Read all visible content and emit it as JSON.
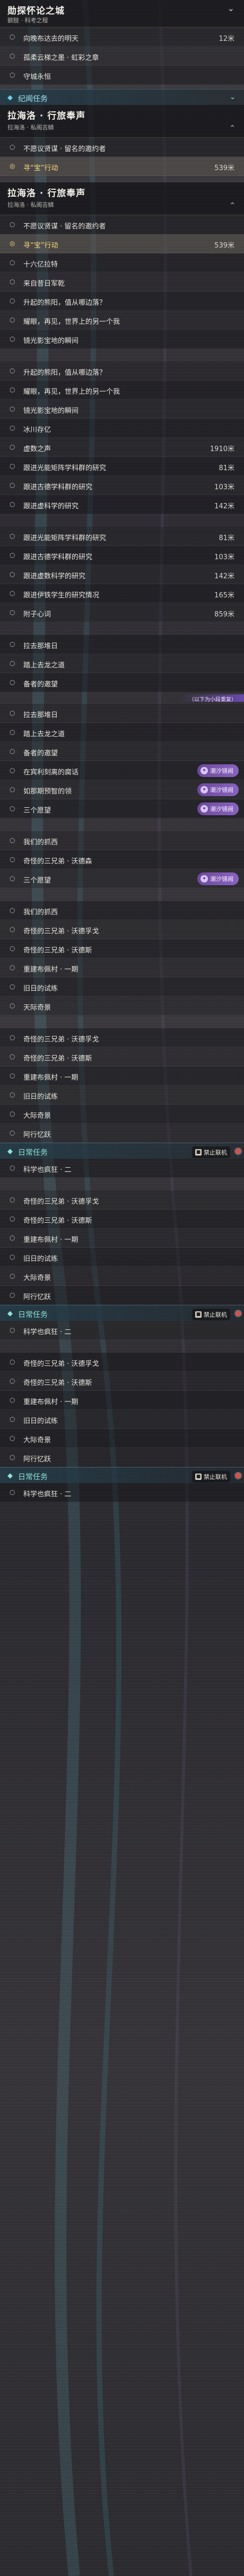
{
  "headers": {
    "h0": {
      "title": "勋探怀论之城",
      "sub": "额肢 · 科考之程"
    },
    "h1": {
      "title": "拉海洛 · 行旅奉声",
      "sub": "拉海洛 · 私阁吉鳞"
    },
    "h2": {
      "title": "拉海洛 · 行旅奉声",
      "sub": "拉海洛 · 私阁吉鳞"
    }
  },
  "sections": {
    "teleport": "纪闻任务",
    "daily": "日常任务"
  },
  "badges": {
    "tide": "潮汐镜阙"
  },
  "locks": {
    "no_coop": "禁止联机"
  },
  "banners": {
    "b1": "（以下为小段重复）"
  },
  "rows": [
    {
      "label": "向晚布达去的明天",
      "dist": "12米"
    },
    {
      "label": "孤柔云梯之墨 · 虹彩之章",
      "dist": ""
    },
    {
      "label": "守城永恒",
      "dist": ""
    },
    {
      "label": "不愿议贤谋 · 留名的邀约者",
      "dist": ""
    },
    {
      "label": "寻“宝”行动",
      "dist": "539米"
    },
    {
      "label": "不愿议贤谋 · 留名的邀约者",
      "dist": ""
    },
    {
      "label": "寻“宝”行动",
      "dist": "539米"
    },
    {
      "label": "十六亿拉特",
      "dist": ""
    },
    {
      "label": "来自昔日军乾",
      "dist": ""
    },
    {
      "label": "升起的熊阳，值从哪边落？",
      "dist": ""
    },
    {
      "label": "耀眼，再见，世界上的另一个我",
      "dist": ""
    },
    {
      "label": "镜光影宝地的瞬间",
      "dist": ""
    },
    {
      "label": "升起的熊阳，值从哪边落？",
      "dist": ""
    },
    {
      "label": "耀眼，再见，世界上的另一个我",
      "dist": ""
    },
    {
      "label": "镜光影宝地的瞬间",
      "dist": ""
    },
    {
      "label": "冰川存亿",
      "dist": ""
    },
    {
      "label": "虚数之声",
      "dist": "1910米"
    },
    {
      "label": "跟进光能矩阵学科群的研究",
      "dist": "81米"
    },
    {
      "label": "跟进古德学科群的研究",
      "dist": "103米"
    },
    {
      "label": "跟进虚科学的研究",
      "dist": "142米"
    },
    {
      "label": "跟进光能矩阵学科群的研究",
      "dist": "81米"
    },
    {
      "label": "跟进古德学科群的研究",
      "dist": "103米"
    },
    {
      "label": "跟进虚数科学的研究",
      "dist": "142米"
    },
    {
      "label": "跟进伊铁学生的研究情况",
      "dist": "165米"
    },
    {
      "label": "附子心词",
      "dist": "859米"
    },
    {
      "label": "拉去那堆日",
      "dist": ""
    },
    {
      "label": "踏上去龙之道",
      "dist": ""
    },
    {
      "label": "备者的邀望",
      "dist": ""
    },
    {
      "label": "拉去那堆日",
      "dist": ""
    },
    {
      "label": "踏上去龙之道",
      "dist": ""
    },
    {
      "label": "备者的邀望",
      "dist": ""
    },
    {
      "label": "在宾利刻离的腐话",
      "dist": ""
    },
    {
      "label": "如那期预智的领",
      "dist": ""
    },
    {
      "label": "三个愿望",
      "dist": ""
    },
    {
      "label": "我们的抓西",
      "dist": ""
    },
    {
      "label": "奇怪的三兄弟 · 沃德森",
      "dist": ""
    },
    {
      "label": "三个愿望",
      "dist": ""
    },
    {
      "label": "我们的抓西",
      "dist": ""
    },
    {
      "label": "奇怪的三兄弟 · 沃德孚戈",
      "dist": ""
    },
    {
      "label": "奇怪的三兄弟 · 沃德斯",
      "dist": ""
    },
    {
      "label": "重建布佩村 · 一期",
      "dist": ""
    },
    {
      "label": "旧日的试练",
      "dist": ""
    },
    {
      "label": "天际奇景",
      "dist": ""
    },
    {
      "label": "奇怪的三兄弟 · 沃德孚戈",
      "dist": ""
    },
    {
      "label": "奇怪的三兄弟 · 沃德斯",
      "dist": ""
    },
    {
      "label": "重建布佩村 · 一期",
      "dist": ""
    },
    {
      "label": "旧日的试练",
      "dist": ""
    },
    {
      "label": "大际奇景",
      "dist": ""
    },
    {
      "label": "阿行忆跃",
      "dist": ""
    },
    {
      "label": "科学也疯狂 · 二",
      "dist": ""
    },
    {
      "label": "奇怪的三兄弟 · 沃德孚戈",
      "dist": ""
    },
    {
      "label": "奇怪的三兄弟 · 沃德斯",
      "dist": ""
    },
    {
      "label": "重建布佩村 · 一期",
      "dist": ""
    },
    {
      "label": "旧日的试练",
      "dist": ""
    },
    {
      "label": "大际奇景",
      "dist": ""
    },
    {
      "label": "阿行忆跃",
      "dist": ""
    },
    {
      "label": "科学也疯狂 · 二",
      "dist": ""
    },
    {
      "label": "奇怪的三兄弟 · 沃德孚戈",
      "dist": ""
    },
    {
      "label": "奇怪的三兄弟 · 沃德斯",
      "dist": ""
    },
    {
      "label": "重建布佩村 · 一期",
      "dist": ""
    },
    {
      "label": "旧日的试练",
      "dist": ""
    },
    {
      "label": "大际奇景",
      "dist": ""
    },
    {
      "label": "阿行忆跃",
      "dist": ""
    },
    {
      "label": "科学也疯狂 · 二",
      "dist": ""
    }
  ],
  "colors": {
    "selected": "#ffd97a",
    "teleport": "#9ee6f4",
    "daily": "#8fe3d3",
    "badge": "#8a62c0",
    "reddot": "#e14d44"
  },
  "icons": {
    "row": "circle-icon",
    "selected": "target-icon",
    "section": "diamond-icon",
    "chevron": "chevron-down-icon",
    "lock": "lock-icon",
    "badge": "tide-icon"
  }
}
